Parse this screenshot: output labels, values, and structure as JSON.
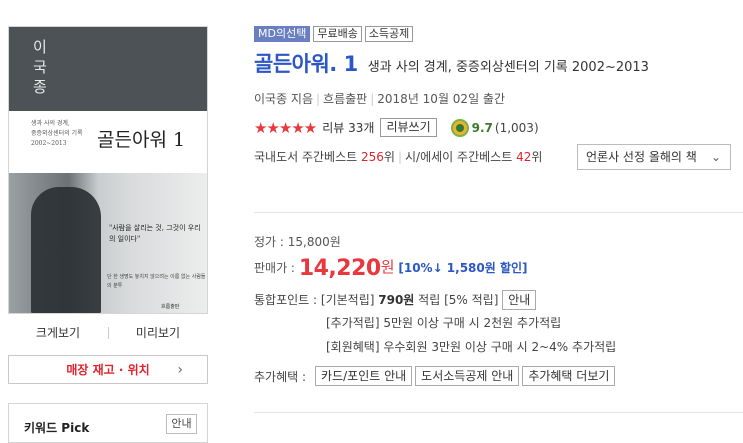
{
  "cover": {
    "author_vertical": "이 국 종",
    "subtitle_lines": [
      "생과 사의 경계,",
      "중증외상센터의 기록",
      "2002~2013"
    ],
    "title": "골든아워 1",
    "quote": "\"사람을 살리는 것, 그것이 우리의 일이다\"",
    "small_text": "단 한 생명도 놓치지 않으려는 이름 없는 사람들의 분투",
    "publisher": "흐름출판"
  },
  "view_links": [
    "크게보기",
    "미리보기"
  ],
  "stock_button": "매장 재고 · 위치",
  "keyword": {
    "title": "키워드 Pick",
    "button": "안내"
  },
  "badges": [
    "MD의선택",
    "무료배송",
    "소득공제"
  ],
  "book": {
    "title": "골든아워. 1",
    "subtitle": "생과 사의 경계, 중증외상센터의 기록 2002~2013",
    "author": "이국종 지음",
    "publisher": "흐름출판",
    "date": "2018년 10월 02일 출간"
  },
  "rating": {
    "stars": "★★★★★",
    "review_label": "리뷰 33개",
    "review_button": "리뷰쓰기",
    "score": "9.7",
    "score_count": "(1,003)",
    "star_value": 5
  },
  "bestseller": {
    "part1_label": "국내도서 주간베스트",
    "part1_rank": "256",
    "part1_unit": "위",
    "part2_label": "시/에세이 주간베스트",
    "part2_rank": "42",
    "part2_unit": "위",
    "dropdown": "언론사 선정 올해의 책"
  },
  "price": {
    "list_label": "정가 : 15,800원",
    "sale_label": "판매가 :",
    "sale_num": "14,220",
    "sale_won": "원",
    "discount": "[10%↓ 1,580원 할인]"
  },
  "points": {
    "label": "통합포인트 :",
    "basic_label": "[기본적립]",
    "basic_value": "790원",
    "basic_suffix": "적립",
    "basic_pct": "[5% 적립]",
    "basic_button": "안내",
    "extra_line": "[추가적립] 5만원 이상 구매 시 2천원 추가적립",
    "member_line": "[회원혜택] 우수회원 3만원 이상 구매 시 2~4% 추가적립"
  },
  "extra_benefits": {
    "label": "추가혜택 :",
    "buttons": [
      "카드/포인트 안내",
      "도서소득공제 안내",
      "추가혜택 더보기"
    ]
  }
}
